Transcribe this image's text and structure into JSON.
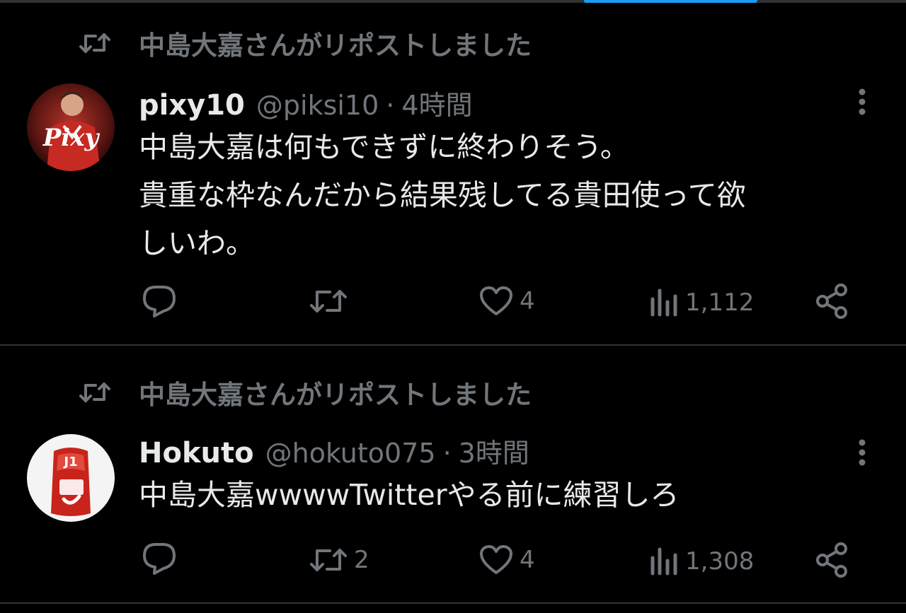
{
  "tweets": [
    {
      "repost_label": "中島大嘉さんがリポストしました",
      "display_name": "pixy10",
      "handle": "@piksi10",
      "separator": "·",
      "time": "4時間",
      "avatar_text": "Pixy",
      "body_lines": [
        "中島大嘉は何もできずに終わりそう。",
        "貴重な枠なんだから結果残してる貴田使って欲",
        "しいわ。"
      ],
      "actions": {
        "reply_count": "",
        "repost_count": "",
        "like_count": "4",
        "views_count": "1,112"
      }
    },
    {
      "repost_label": "中島大嘉さんがリポストしました",
      "display_name": "Hokuto",
      "handle": "@hokuto075",
      "separator": "·",
      "time": "3時間",
      "avatar_text": "J1",
      "body_lines": [
        "中島大嘉wwwwTwitterやる前に練習しろ"
      ],
      "actions": {
        "reply_count": "",
        "repost_count": "2",
        "like_count": "4",
        "views_count": "1,308"
      }
    }
  ],
  "icons": {
    "repost": "repost-icon",
    "reply": "reply-icon",
    "like": "heart-icon",
    "views": "views-chart-icon",
    "share": "share-icon",
    "more": "more-vertical-icon"
  },
  "colors": {
    "background": "#000000",
    "text_primary": "#e7e9ea",
    "text_secondary": "#71767b",
    "divider": "#2f3336",
    "accent": "#1d9bf0"
  }
}
